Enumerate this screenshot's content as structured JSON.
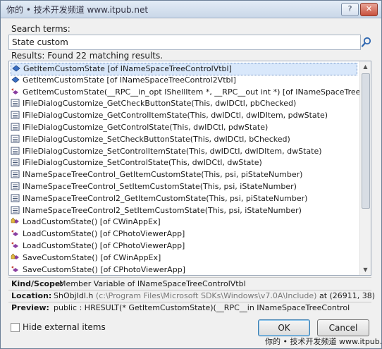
{
  "window": {
    "title_overlay": "你的 • 技术开发频道 www.itpub.net",
    "help_label": "?",
    "close_label": "✕"
  },
  "search": {
    "label": "Search terms:",
    "value": "State custom",
    "icon": "search-icon"
  },
  "results": {
    "summary": "Results: Found 22 matching results.",
    "items": [
      {
        "icon": "field-icon",
        "text": "GetItemCustomState [of INameSpaceTreeControlVtbl]",
        "selected": true
      },
      {
        "icon": "field-icon",
        "text": "GetItemCustomState [of INameSpaceTreeControl2Vtbl]",
        "selected": false
      },
      {
        "icon": "method-icon",
        "text": "GetItemCustomState(__RPC__in_opt IShellItem *, __RPC__out int *) [of INameSpaceTreeControl]",
        "selected": false
      },
      {
        "icon": "macro-icon",
        "text": "IFileDialogCustomize_GetCheckButtonState(This, dwIDCtl, pbChecked)",
        "selected": false
      },
      {
        "icon": "macro-icon",
        "text": "IFileDialogCustomize_GetControlItemState(This, dwIDCtl, dwIDItem, pdwState)",
        "selected": false
      },
      {
        "icon": "macro-icon",
        "text": "IFileDialogCustomize_GetControlState(This, dwIDCtl, pdwState)",
        "selected": false
      },
      {
        "icon": "macro-icon",
        "text": "IFileDialogCustomize_SetCheckButtonState(This, dwIDCtl, bChecked)",
        "selected": false
      },
      {
        "icon": "macro-icon",
        "text": "IFileDialogCustomize_SetControlItemState(This, dwIDCtl, dwIDItem, dwState)",
        "selected": false
      },
      {
        "icon": "macro-icon",
        "text": "IFileDialogCustomize_SetControlState(This, dwIDCtl, dwState)",
        "selected": false
      },
      {
        "icon": "macro-icon",
        "text": "INameSpaceTreeControl_GetItemCustomState(This, psi, piStateNumber)",
        "selected": false
      },
      {
        "icon": "macro-icon",
        "text": "INameSpaceTreeControl_SetItemCustomState(This, psi, iStateNumber)",
        "selected": false
      },
      {
        "icon": "macro-icon",
        "text": "INameSpaceTreeControl2_GetItemCustomState(This, psi, piStateNumber)",
        "selected": false
      },
      {
        "icon": "macro-icon",
        "text": "INameSpaceTreeControl2_SetItemCustomState(This, psi, iStateNumber)",
        "selected": false
      },
      {
        "icon": "protected-method-icon",
        "text": "LoadCustomState() [of CWinAppEx]",
        "selected": false
      },
      {
        "icon": "method-icon",
        "text": "LoadCustomState() [of CPhotoViewerApp]",
        "selected": false
      },
      {
        "icon": "method-icon",
        "text": "LoadCustomState() [of CPhotoViewerApp]",
        "selected": false
      },
      {
        "icon": "protected-method-icon",
        "text": "SaveCustomState() [of CWinAppEx]",
        "selected": false
      },
      {
        "icon": "method-icon",
        "text": "SaveCustomState() [of CPhotoViewerApp]",
        "selected": false
      }
    ]
  },
  "details": {
    "kind_label": "Kind/Scope:",
    "kind_value": "Member Variable of INameSpaceTreeControlVtbl",
    "location_label": "Location:",
    "location_file": "ShObjIdl.h",
    "location_path": "(c:\\Program Files\\Microsoft SDKs\\Windows\\v7.0A\\Include)",
    "location_pos": "at (26911, 38)",
    "preview_label": "Preview:",
    "preview_value": "public : HRESULT(* GetItemCustomState)(__RPC__in INameSpaceTreeControl"
  },
  "footer": {
    "hide_external_label": "Hide external items",
    "hide_external_checked": false,
    "ok_label": "OK",
    "cancel_label": "Cancel",
    "watermark": "你的 • 技术开发频道 www.itpub.net"
  },
  "colors": {
    "selection": "#d9e8fb",
    "field_icon": "#3a6fc4",
    "method_icon": "#8a3ea0",
    "macro_icon": "#4a5a78"
  }
}
